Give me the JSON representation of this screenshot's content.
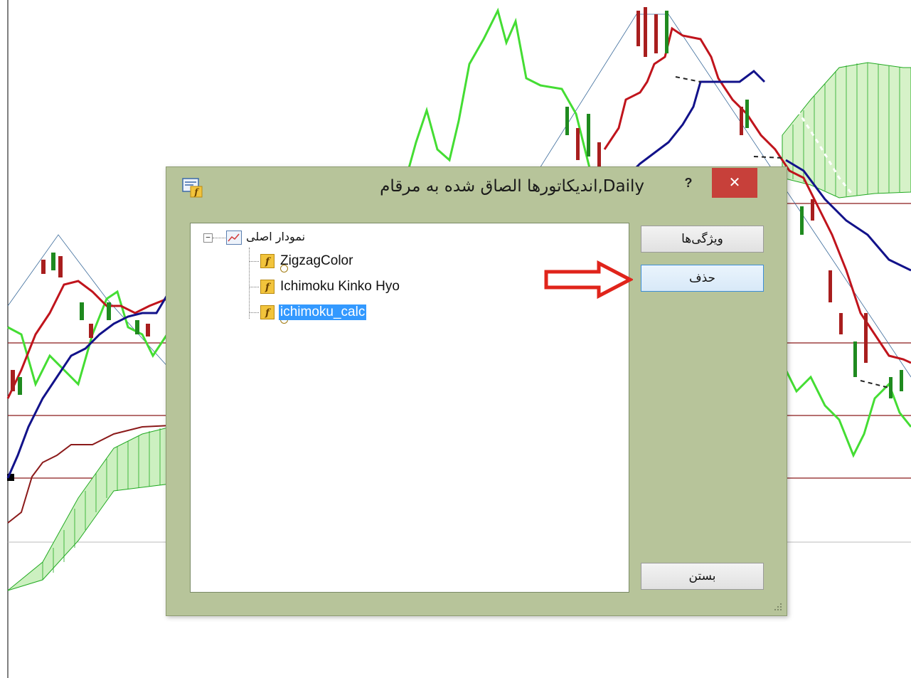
{
  "dialog": {
    "title": "Daily,اندیکاتورها الصاق شده به مرقام",
    "help_label": "?",
    "close_label": "✕",
    "app_icon": "indicator-window-icon"
  },
  "tree": {
    "root": {
      "label": "نمودار اصلی",
      "expander": "−",
      "icon": "chart-window-icon"
    },
    "items": [
      {
        "label": "ZigzagColor",
        "icon": "custom-indicator-icon",
        "selected": false
      },
      {
        "label": "Ichimoku Kinko Hyo",
        "icon": "indicator-icon",
        "selected": false
      },
      {
        "label": "ichimoku_calc",
        "icon": "custom-indicator-icon",
        "selected": true
      }
    ]
  },
  "buttons": {
    "properties": "ویژگی‌ها",
    "delete": "حذف",
    "close": "بستن"
  },
  "colors": {
    "selection": "#3399ff",
    "close_button": "#c7403a",
    "dialog_frame": "#b7c49a",
    "annotation_arrow": "#e0241b",
    "tenkan_line": "#c0141c",
    "kijun_line": "#12128a",
    "chikou_line": "#44dd33",
    "kumo_fill": "#22aa22"
  }
}
